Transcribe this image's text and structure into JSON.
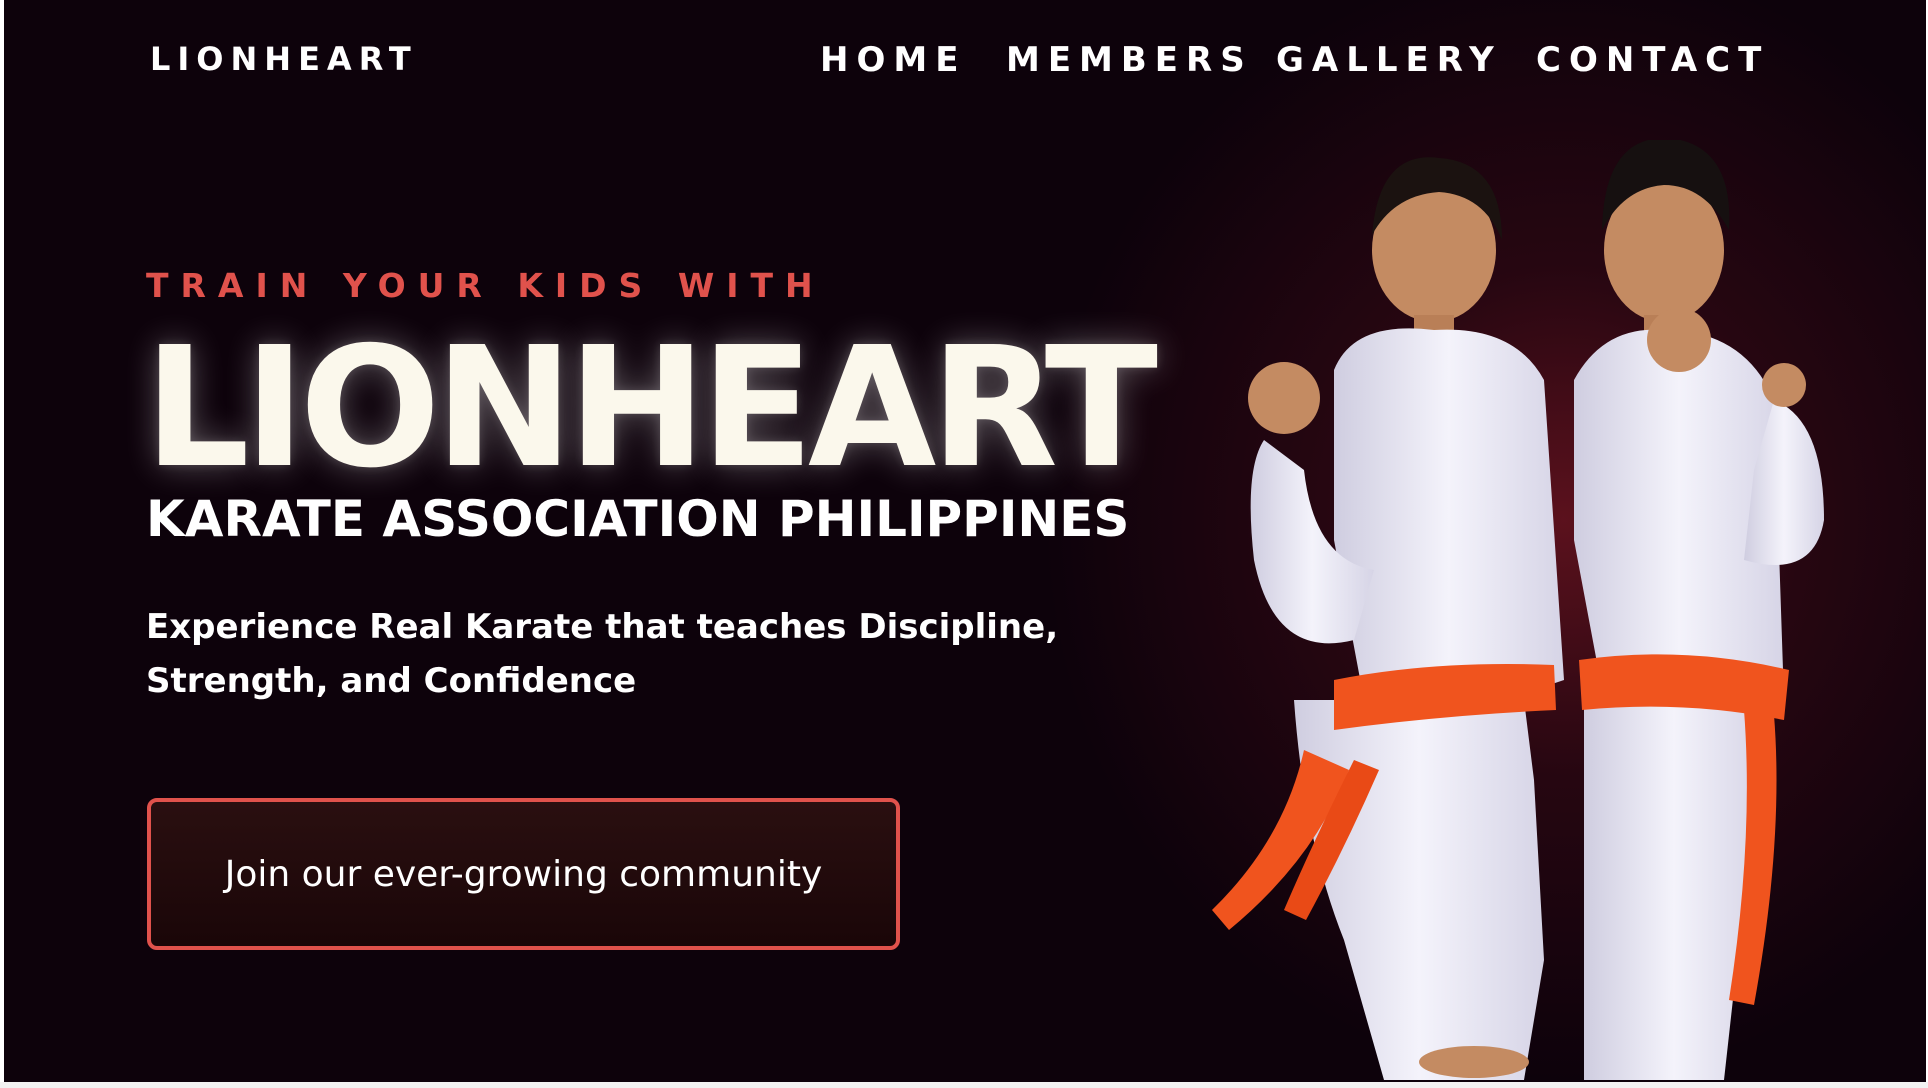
{
  "brand": {
    "name": "LIONHEART"
  },
  "nav": {
    "items": [
      {
        "label": "HOME"
      },
      {
        "label": "MEMBERS"
      },
      {
        "label": "GALLERY"
      },
      {
        "label": "CONTACT"
      }
    ]
  },
  "hero": {
    "kicker": "TRAIN YOUR KIDS WITH",
    "title": "LIONHEART",
    "subtitle": "KARATE ASSOCIATION PHILIPPINES",
    "description_line1": "Experience Real Karate that teaches Discipline,",
    "description_line2": "Strength, and Confidence",
    "cta_label": "Join our ever-growing community"
  },
  "colors": {
    "background": "#0d020b",
    "accent": "#e0524c",
    "title": "#fbf8ec",
    "belt": "#f0541e"
  }
}
